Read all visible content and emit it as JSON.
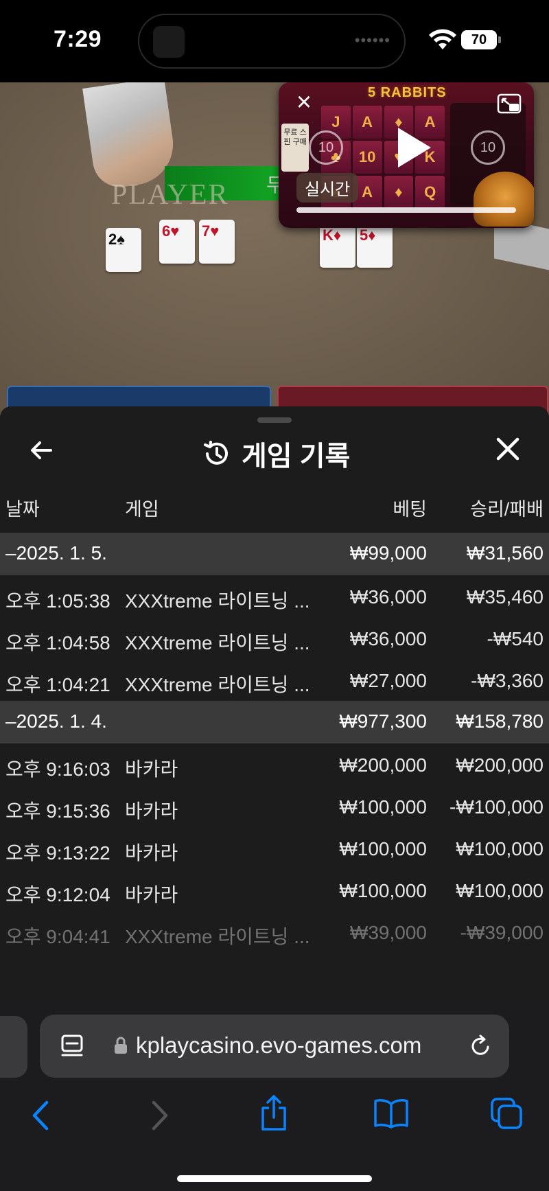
{
  "status": {
    "time": "7:29",
    "battery": "70"
  },
  "game": {
    "player_label": "PLAYER",
    "green_bar_text": "두",
    "cards": [
      "2♠",
      "6♥",
      "7♥",
      "K♦",
      "5♦"
    ]
  },
  "pip": {
    "banner": "5 RABBITS",
    "live_label": "실시간",
    "skip_back": "10",
    "skip_forward": "10",
    "side_text": "무료 스핀 구매"
  },
  "history": {
    "title": "게임 기록",
    "columns": {
      "time": "날짜",
      "game": "게임",
      "bet": "베팅",
      "win": "승리/패배"
    },
    "groups": [
      {
        "date": "–2025. 1. 5.",
        "bet": "₩99,000",
        "win": "₩31,560",
        "rows": [
          {
            "time": "오후 1:05:38",
            "game": "XXXtreme 라이트닝 ...",
            "bet": "₩36,000",
            "win": "₩35,460"
          },
          {
            "time": "오후 1:04:58",
            "game": "XXXtreme 라이트닝 ...",
            "bet": "₩36,000",
            "win": "-₩540"
          },
          {
            "time": "오후 1:04:21",
            "game": "XXXtreme 라이트닝 ...",
            "bet": "₩27,000",
            "win": "-₩3,360"
          }
        ]
      },
      {
        "date": "–2025. 1. 4.",
        "bet": "₩977,300",
        "win": "₩158,780",
        "rows": [
          {
            "time": "오후 9:16:03",
            "game": "바카라",
            "bet": "₩200,000",
            "win": "₩200,000"
          },
          {
            "time": "오후 9:15:36",
            "game": "바카라",
            "bet": "₩100,000",
            "win": "-₩100,000"
          },
          {
            "time": "오후 9:13:22",
            "game": "바카라",
            "bet": "₩100,000",
            "win": "₩100,000"
          },
          {
            "time": "오후 9:12:04",
            "game": "바카라",
            "bet": "₩100,000",
            "win": "₩100,000"
          },
          {
            "time": "오후 9:04:41",
            "game": "XXXtreme 라이트닝 ...",
            "bet": "₩39,000",
            "win": "-₩39,000"
          }
        ]
      }
    ]
  },
  "browser": {
    "url": "kplaycasino.evo-games.com"
  },
  "colors": {
    "accent": "#0a84ff",
    "panel_bg": "#1c1c1c",
    "group_bg": "#3a3a3a"
  }
}
